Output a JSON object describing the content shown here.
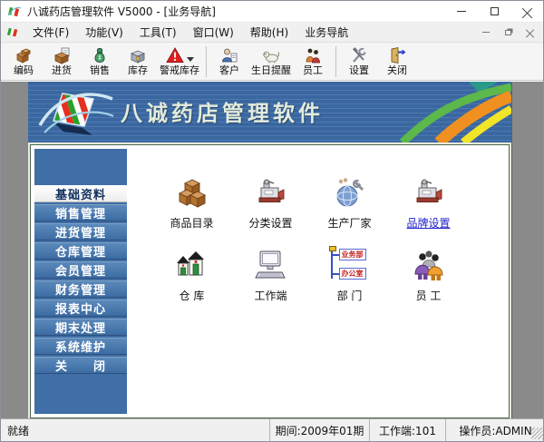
{
  "window": {
    "title": "八诚药店管理软件 V5000 - [业务导航]"
  },
  "menu": {
    "items": [
      {
        "label": "文件(F)"
      },
      {
        "label": "功能(V)"
      },
      {
        "label": "工具(T)"
      },
      {
        "label": "窗口(W)"
      },
      {
        "label": "帮助(H)"
      },
      {
        "label": "业务导航"
      }
    ]
  },
  "toolbar": {
    "buttons": [
      {
        "label": "编码",
        "icon": "code-boxes-icon"
      },
      {
        "label": "进货",
        "icon": "purchase-icon"
      },
      {
        "label": "销售",
        "icon": "sales-moneybag-icon"
      },
      {
        "label": "库存",
        "icon": "stock-box-icon"
      },
      {
        "label": "警戒库存",
        "icon": "stock-alert-icon",
        "has_dropdown": true
      },
      {
        "label": "客户",
        "icon": "customer-icon"
      },
      {
        "label": "生日提醒",
        "icon": "birthday-reminder-icon"
      },
      {
        "label": "员工",
        "icon": "staff-icon"
      },
      {
        "label": "设置",
        "icon": "settings-icon"
      },
      {
        "label": "关闭",
        "icon": "exit-door-icon"
      }
    ]
  },
  "banner": {
    "title": "八诚药店管理软件"
  },
  "sidebar": {
    "items": [
      {
        "label": "基础资料",
        "active": true
      },
      {
        "label": "销售管理",
        "active": false
      },
      {
        "label": "进货管理",
        "active": false
      },
      {
        "label": "仓库管理",
        "active": false
      },
      {
        "label": "会员管理",
        "active": false
      },
      {
        "label": "财务管理",
        "active": false
      },
      {
        "label": "报表中心",
        "active": false
      },
      {
        "label": "期末处理",
        "active": false
      },
      {
        "label": "系统维护",
        "active": false
      },
      {
        "label": "关　　闭",
        "active": false
      }
    ]
  },
  "main": {
    "shortcuts": [
      {
        "label": "商品目录",
        "icon": "goods-catalog-icon",
        "link": false
      },
      {
        "label": "分类设置",
        "icon": "category-settings-icon",
        "link": false
      },
      {
        "label": "生产厂家",
        "icon": "manufacturer-icon",
        "link": false
      },
      {
        "label": "品牌设置",
        "icon": "brand-settings-icon",
        "link": true
      },
      {
        "label": "仓 库",
        "icon": "warehouse-icon",
        "link": false
      },
      {
        "label": "工作端",
        "icon": "workstation-icon",
        "link": false
      },
      {
        "label": "部 门",
        "icon": "department-tree-icon",
        "link": false
      },
      {
        "label": "员 工",
        "icon": "employees-icon",
        "link": false
      }
    ],
    "department_nodes": [
      "业务部",
      "办公室"
    ]
  },
  "statusbar": {
    "ready": "就绪",
    "period": "期间:2009年01期",
    "workstation": "工作端:101",
    "operator": "操作员:ADMIN"
  },
  "colors": {
    "banner_blue": "#3a67a0",
    "sidebar_blue": "#406ea6",
    "link_blue": "#2222cc",
    "alert_red": "#e02020",
    "mdi_gray": "#8a8a8a"
  }
}
